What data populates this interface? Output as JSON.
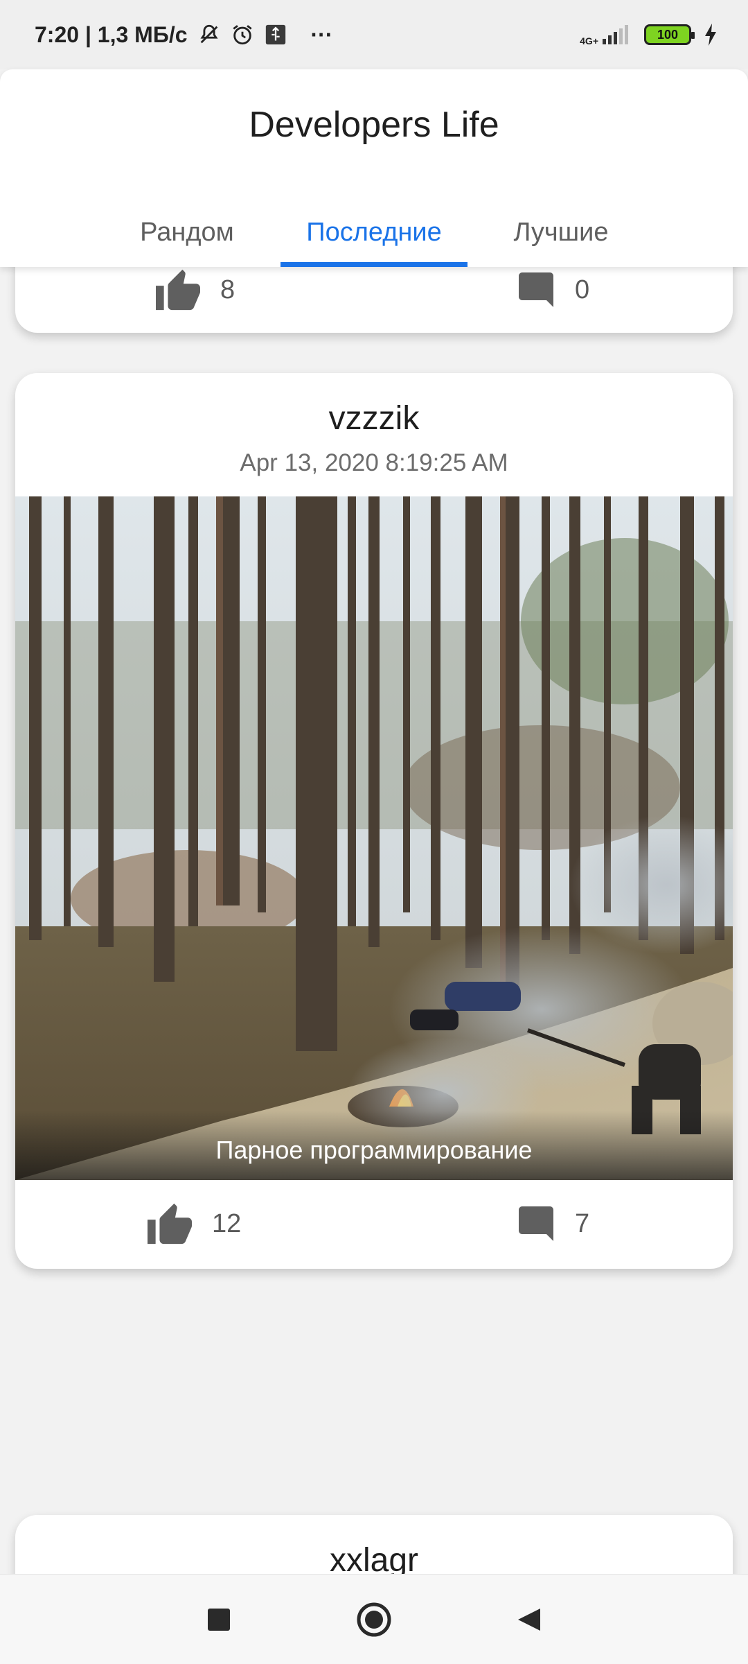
{
  "status_bar": {
    "time_speed": "7:20 | 1,3 МБ/с",
    "network": "4G+",
    "battery": "100",
    "more": "···",
    "icons": [
      "mute-icon",
      "alarm-icon",
      "usb-icon",
      "signal-icon",
      "battery-icon",
      "charging-icon"
    ]
  },
  "header": {
    "title": "Developers Life",
    "tabs": [
      {
        "label": "Рандом",
        "active": false
      },
      {
        "label": "Последние",
        "active": true
      },
      {
        "label": "Лучшие",
        "active": false
      }
    ]
  },
  "posts": [
    {
      "likes": "8",
      "comments": "0"
    },
    {
      "author": "vzzzik",
      "date": "Apr 13, 2020 8:19:25 AM",
      "caption": "Парное программирование",
      "likes": "12",
      "comments": "7"
    },
    {
      "author": "xxlagr"
    }
  ],
  "colors": {
    "accent": "#1a73e8",
    "text_secondary": "#6c6c6c",
    "icon": "#5a5a5a"
  },
  "nav_bar": {
    "icons": [
      "recents-square-icon",
      "home-circle-icon",
      "back-triangle-icon"
    ]
  }
}
